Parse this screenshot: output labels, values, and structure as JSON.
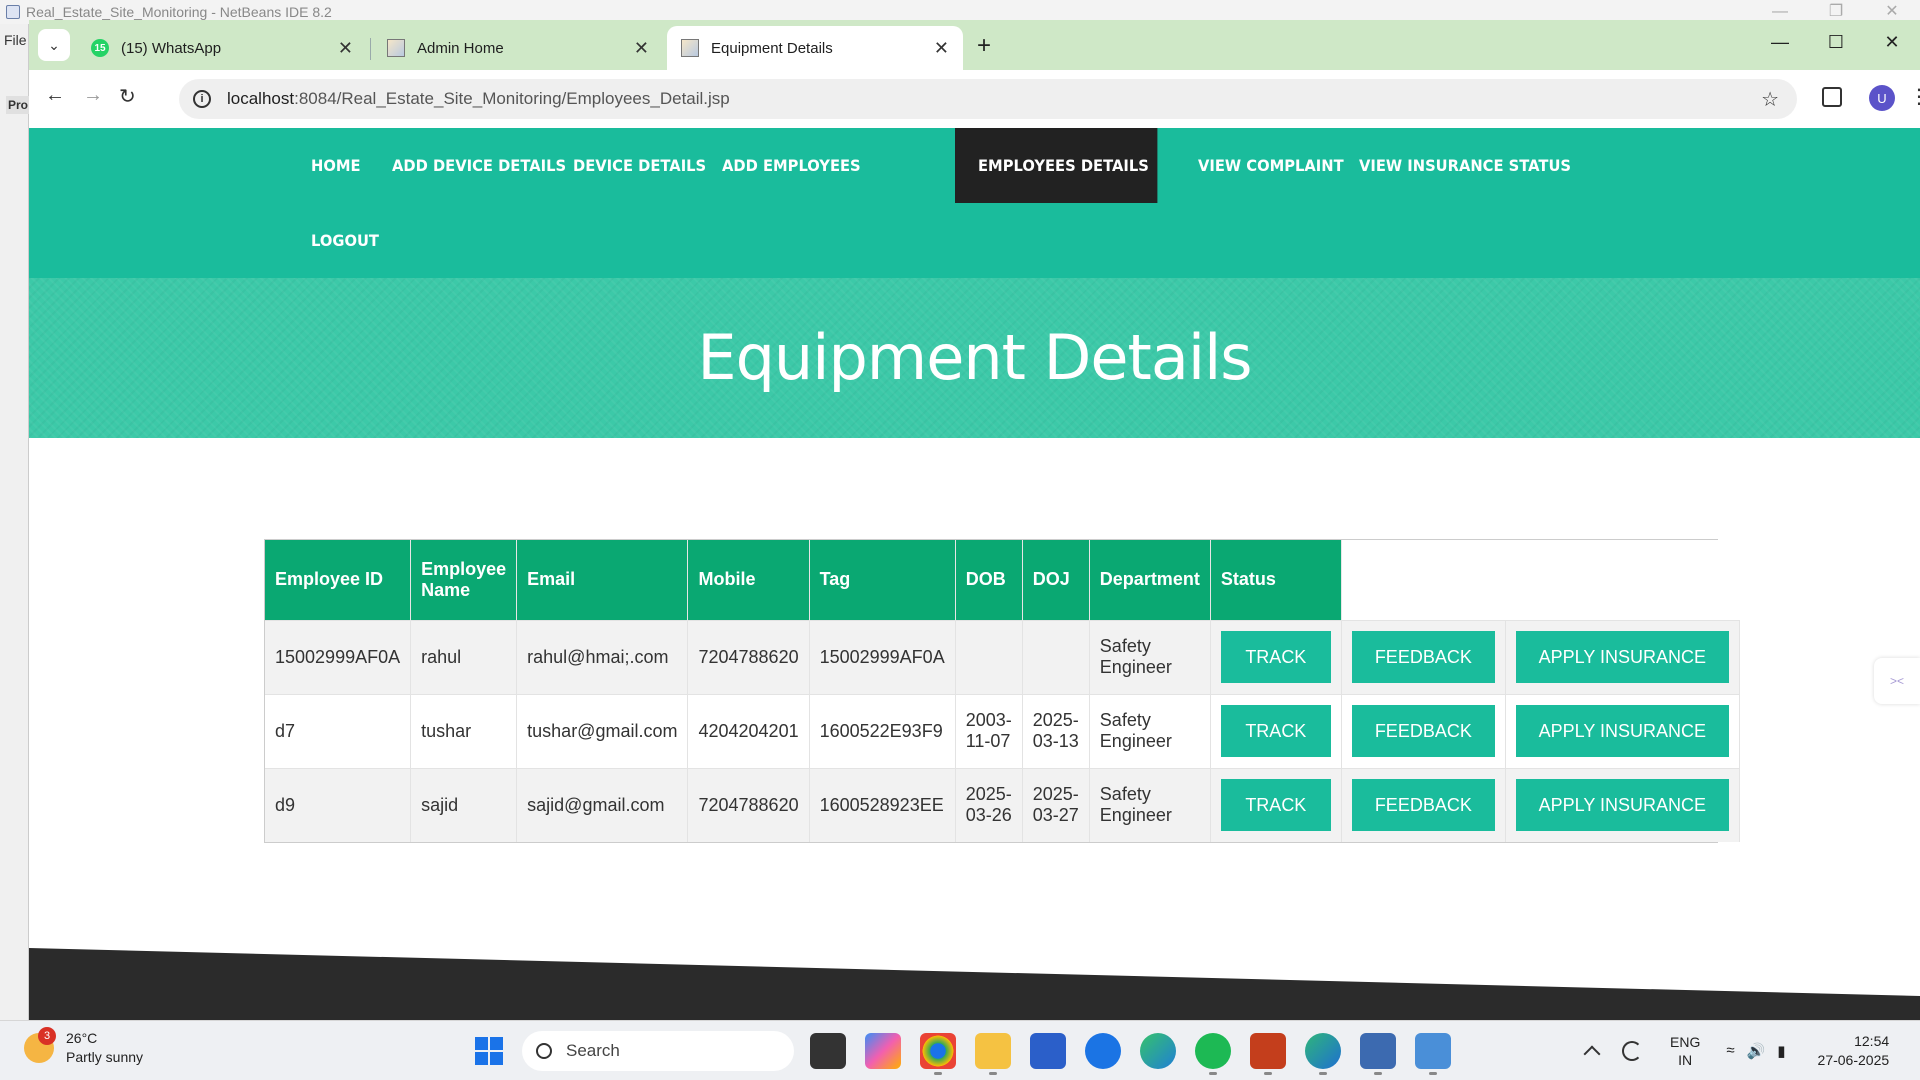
{
  "background_window": {
    "title": "Real_Estate_Site_Monitoring - NetBeans IDE 8.2",
    "menu_file": "File",
    "projects_tab": "Pro"
  },
  "browser": {
    "tabs": [
      {
        "title": "(15) WhatsApp",
        "badge": "15",
        "icon": "whatsapp-icon"
      },
      {
        "title": "Admin Home",
        "icon": "page-image-icon"
      },
      {
        "title": "Equipment Details",
        "icon": "page-image-icon",
        "active": true
      }
    ],
    "url_host": "localhost",
    "url_path": ":8084/Real_Estate_Site_Monitoring/Employees_Detail.jsp",
    "profile_initial": "U"
  },
  "nav": {
    "items": [
      "Home",
      "Add Device Details",
      "Device Details",
      "Add Employees",
      "Employees Details",
      "View Complaint",
      "View Insurance Status",
      "Logout"
    ],
    "active_index": 4
  },
  "banner": {
    "title": "Equipment Details"
  },
  "table": {
    "headers": [
      "Employee ID",
      "Employee Name",
      "Email",
      "Mobile",
      "Tag",
      "DOB",
      "DOJ",
      "Department",
      "Status"
    ],
    "rows": [
      {
        "id": "15002999AF0A",
        "name": "rahul",
        "email": "rahul@hmai;.com",
        "mobile": "7204788620",
        "tag": "15002999AF0A",
        "dob": "",
        "doj": "",
        "department": "Safety Engineer"
      },
      {
        "id": "d7",
        "name": "tushar",
        "email": "tushar@gmail.com",
        "mobile": "4204204201",
        "tag": "1600522E93F9",
        "dob": "2003-11-07",
        "doj": "2025-03-13",
        "department": "Safety Engineer"
      },
      {
        "id": "d9",
        "name": "sajid",
        "email": "sajid@gmail.com",
        "mobile": "7204788620",
        "tag": "1600528923EE",
        "dob": "2025-03-26",
        "doj": "2025-03-27",
        "department": "Safety Engineer"
      }
    ],
    "actions": {
      "track": "TRACK",
      "feedback": "FEEDBACK",
      "apply": "APPLY INSURANCE"
    }
  },
  "colors": {
    "accent": "#1abc9c",
    "header_green": "#0aa872",
    "nav_active_bg": "#222222",
    "footer": "#2b2b2b"
  },
  "taskbar": {
    "weather_temp": "26°C",
    "weather_desc": "Partly sunny",
    "weather_badge": "3",
    "search_placeholder": "Search",
    "lang_line1": "ENG",
    "lang_line2": "IN",
    "time": "12:54",
    "date": "27-06-2025"
  }
}
